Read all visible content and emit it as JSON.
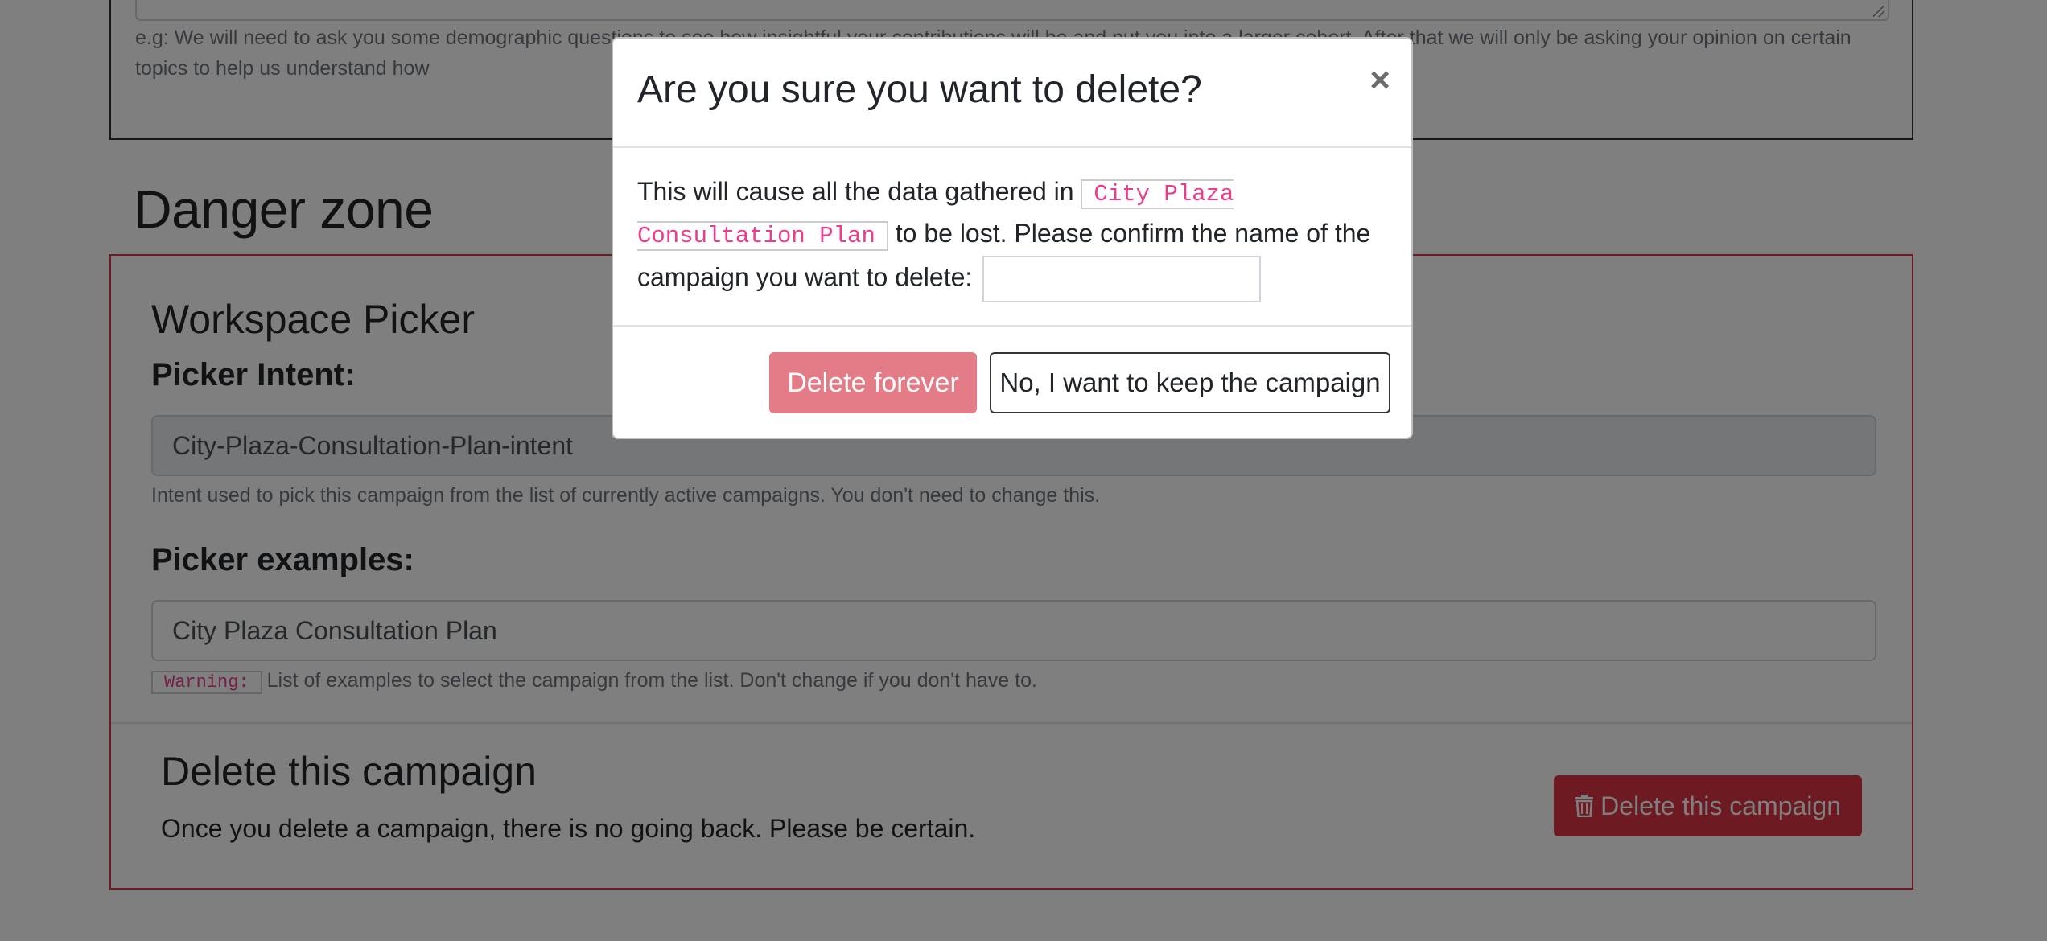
{
  "description": {
    "help_text": "e.g: We will need to ask you some demographic questions to see how insightful your contributions will be and put you into a larger cohort. After that we will only be asking your opinion on certain topics to help us understand how"
  },
  "danger_zone": {
    "title": "Danger zone",
    "workspace_picker": {
      "title": "Workspace Picker",
      "intent_label": "Picker Intent:",
      "intent_value": "City-Plaza-Consultation-Plan-intent",
      "intent_help": "Intent used to pick this campaign from the list of currently active campaigns. You don't need to change this.",
      "examples_label": "Picker examples:",
      "examples_value": "City Plaza Consultation Plan",
      "warning_tag": "Warning:",
      "examples_help": "List of examples to select the campaign from the list. Don't change if you don't have to."
    },
    "delete_section": {
      "title": "Delete this campaign",
      "description": "Once you delete a campaign, there is no going back. Please be certain.",
      "button_label": "Delete this campaign",
      "button_icon": "trash-icon"
    }
  },
  "modal": {
    "title": "Are you sure you want to delete?",
    "close_symbol": "×",
    "body_prefix": "This will cause all the data gathered in ",
    "campaign_name": "City Plaza Consultation Plan",
    "body_suffix": " to be lost. Please confirm the name of the campaign you want to delete: ",
    "confirm_input_value": "",
    "delete_button_label": "Delete forever",
    "keep_button_label": "No, I want to keep the campaign"
  },
  "colors": {
    "danger": "#dc3545",
    "danger_disabled": "#e37c87",
    "code_pink": "#e83e8c",
    "backdrop": "rgba(0,0,0,0.5)"
  }
}
